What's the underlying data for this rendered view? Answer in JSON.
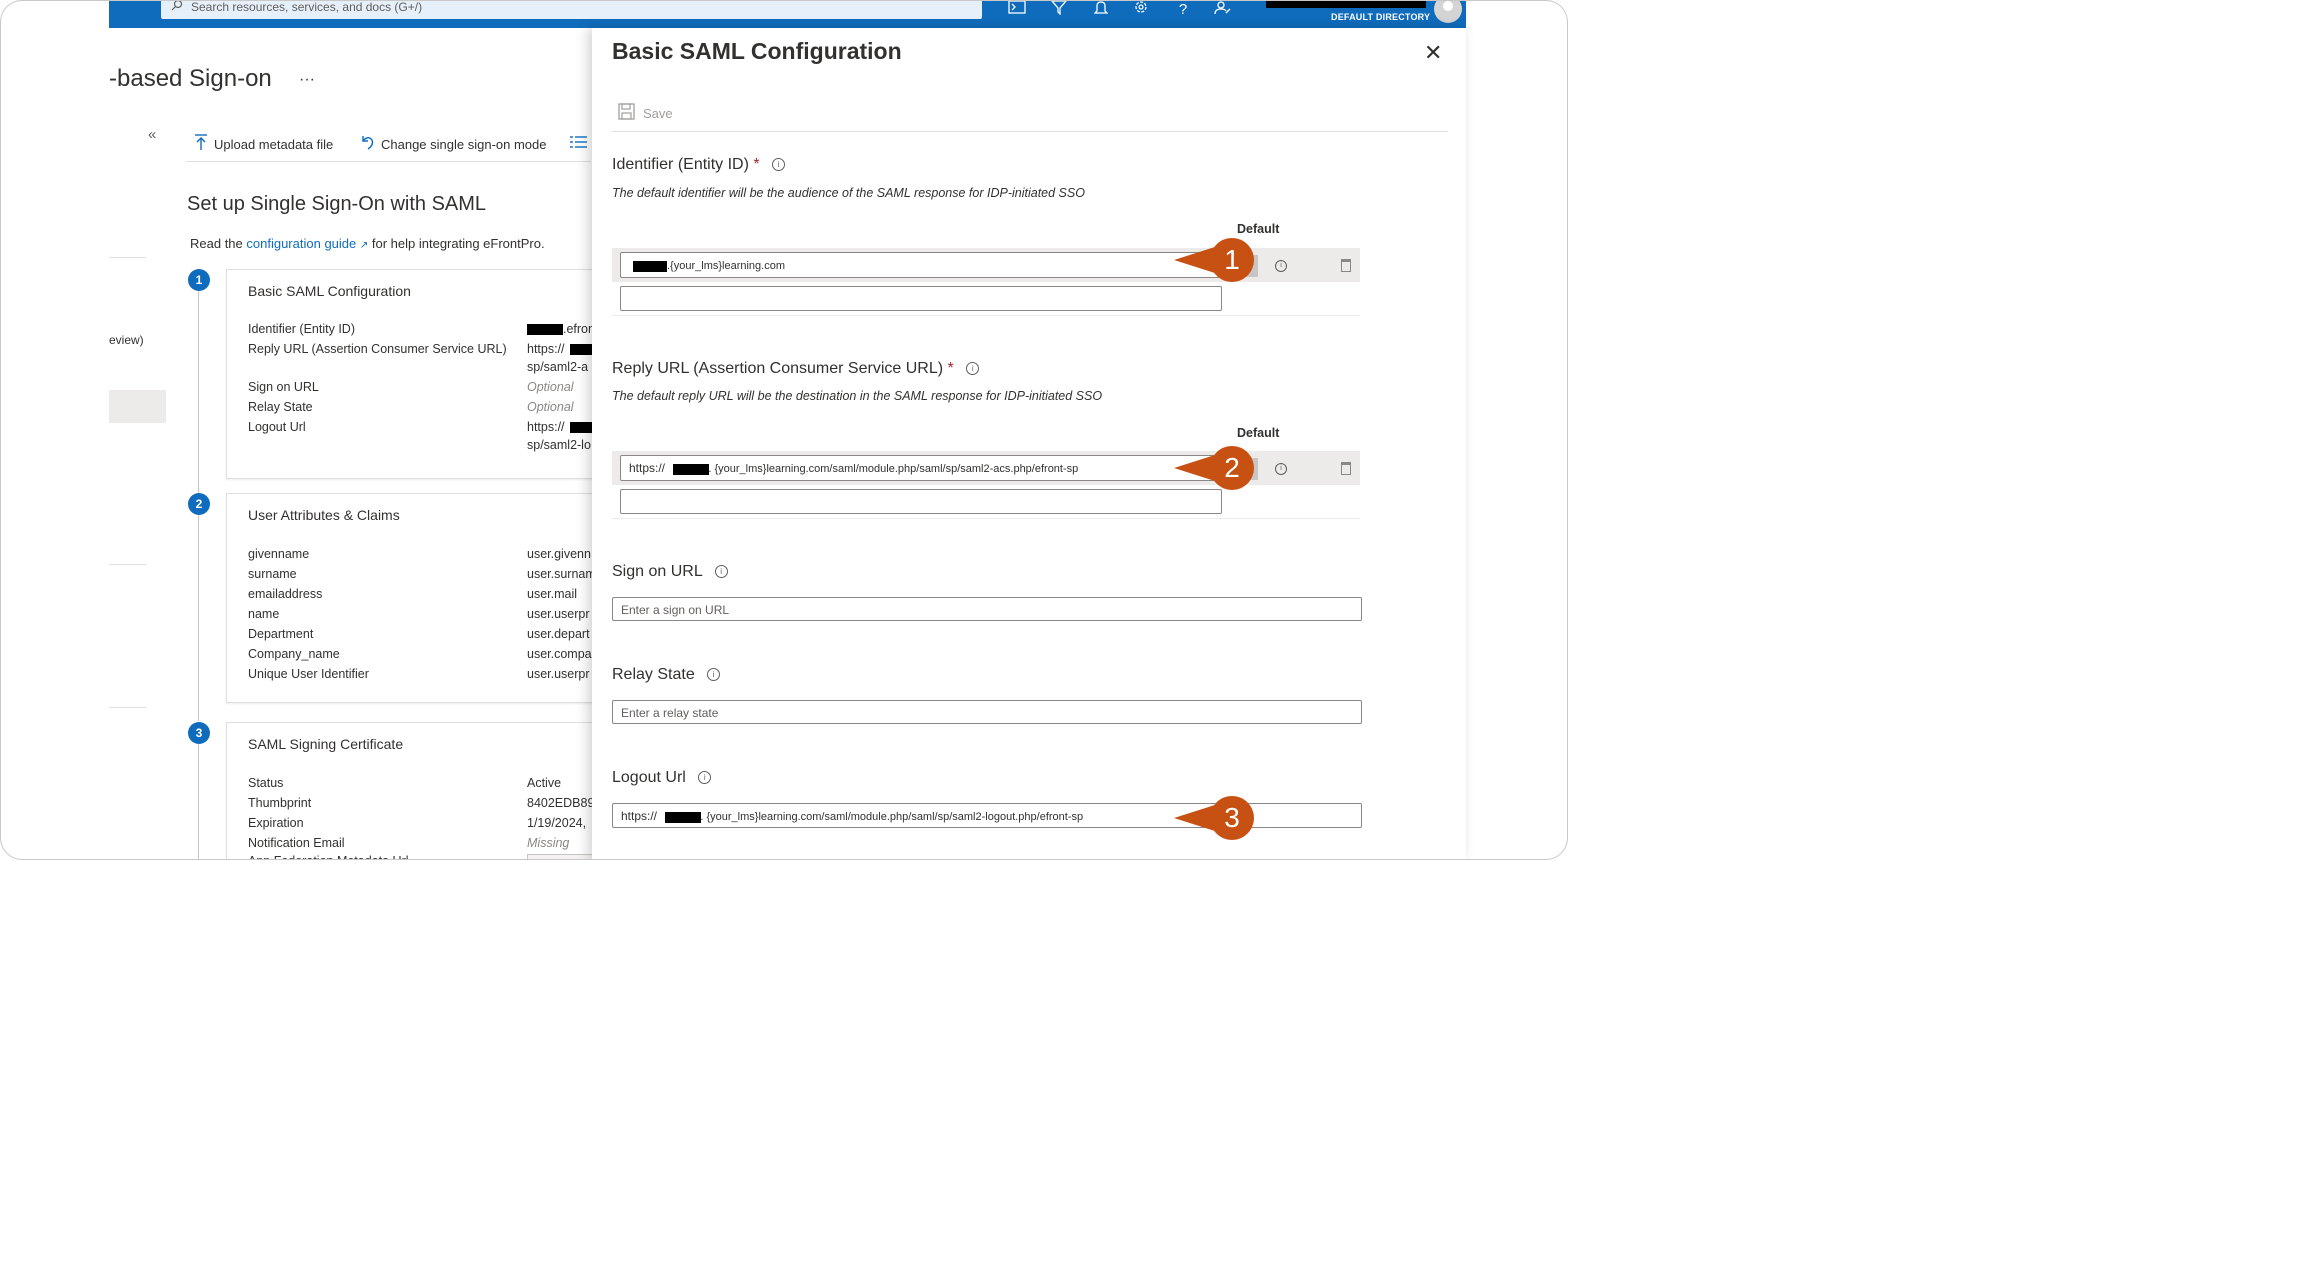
{
  "topbar": {
    "search_placeholder": "Search resources, services, and docs (G+/)",
    "directory": "DEFAULT DIRECTORY",
    "icons": [
      "cloud-shell-icon",
      "filter-icon",
      "bell-icon",
      "gear-icon",
      "help-icon",
      "feedback-icon"
    ]
  },
  "page": {
    "title": "-based Sign-on",
    "ellipsis": "···",
    "collapse": "«",
    "left_partial": "eview)",
    "commands": [
      "Upload metadata file",
      "Change single sign-on mode"
    ],
    "setup_title": "Set up Single Sign-On with SAML",
    "read_prefix": "Read the",
    "guide_link": "configuration guide",
    "read_suffix": "for help integrating eFrontPro."
  },
  "steps": [
    {
      "number": "1",
      "title": "Basic SAML Configuration",
      "rows": [
        {
          "key": "Identifier (Entity ID)",
          "value": ".efron"
        },
        {
          "key": "Reply URL (Assertion Consumer Service URL)",
          "value": "https://",
          "value2": "sp/saml2-a"
        },
        {
          "key": "Sign on URL",
          "value": "Optional"
        },
        {
          "key": "Relay State",
          "value": "Optional"
        },
        {
          "key": "Logout Url",
          "value": "https://",
          "value2": "sp/saml2-lo"
        }
      ]
    },
    {
      "number": "2",
      "title": "User Attributes & Claims",
      "rows": [
        {
          "key": "givenname",
          "value": "user.givenn"
        },
        {
          "key": "surname",
          "value": "user.surnam"
        },
        {
          "key": "emailaddress",
          "value": "user.mail"
        },
        {
          "key": "name",
          "value": "user.userpr"
        },
        {
          "key": "Department",
          "value": "user.depart"
        },
        {
          "key": "Company_name",
          "value": "user.compa"
        },
        {
          "key": "Unique User Identifier",
          "value": "user.userpr"
        }
      ]
    },
    {
      "number": "3",
      "title": "SAML Signing Certificate",
      "rows": [
        {
          "key": "Status",
          "value": "Active"
        },
        {
          "key": "Thumbprint",
          "value": "8402EDB89"
        },
        {
          "key": "Expiration",
          "value": "1/19/2024,"
        },
        {
          "key": "Notification Email",
          "value": "Missing"
        },
        {
          "key": "App Federation Metadata Url",
          "value": ""
        }
      ]
    }
  ],
  "panel": {
    "title": "Basic SAML Configuration",
    "close": "✕",
    "save": "Save",
    "default_label": "Default",
    "identifier": {
      "label": "Identifier (Entity ID)",
      "required": "*",
      "desc": "The default identifier will be the audience of the SAML response for IDP-initiated SSO",
      "value": ".{your_lms}learning.com"
    },
    "reply": {
      "label": "Reply URL (Assertion Consumer Service URL)",
      "required": "*",
      "desc": "The default reply URL will be the destination in the SAML response for IDP-initiated SSO",
      "value_prefix": "https://",
      "value": ". {your_lms}learning.com/saml/module.php/saml/sp/saml2-acs.php/efront-sp"
    },
    "signon": {
      "label": "Sign on URL",
      "placeholder": "Enter a sign on URL"
    },
    "relay": {
      "label": "Relay State",
      "placeholder": "Enter a relay state"
    },
    "logout": {
      "label": "Logout Url",
      "value_prefix": "https://",
      "value": ". {your_lms}learning.com/saml/module.php/saml/sp/saml2-logout.php/efront-sp"
    }
  },
  "callouts": [
    "1",
    "2",
    "3"
  ],
  "colors": {
    "accent": "#0f6cbd",
    "callout": "#c75112",
    "required": "#a4262c"
  }
}
